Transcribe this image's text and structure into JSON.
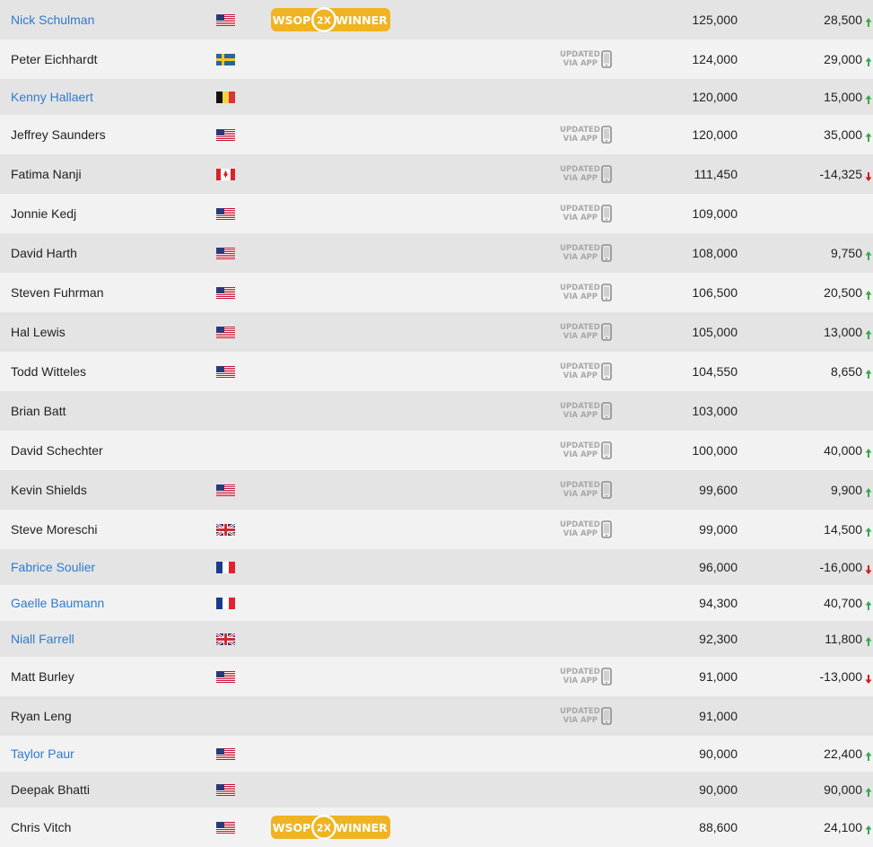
{
  "badge": {
    "left": "WSOP",
    "center": "2X",
    "right": "WINNER"
  },
  "app_badge": {
    "line1": "UPDATED",
    "line2": "VIA APP",
    "icon": "phone-icon"
  },
  "colors": {
    "link": "#2e7bd1",
    "up": "#3aa84a",
    "down": "#d0191e",
    "badge": "#f0b323",
    "row_odd": "#e4e4e4",
    "row_even": "#f2f2f2"
  },
  "players": [
    {
      "name": "Nick Schulman",
      "link": true,
      "flag": "us",
      "badge": true,
      "app": false,
      "chips": "125,000",
      "change": "28,500",
      "trend": "up"
    },
    {
      "name": "Peter Eichhardt",
      "link": false,
      "flag": "se",
      "badge": false,
      "app": true,
      "chips": "124,000",
      "change": "29,000",
      "trend": "up"
    },
    {
      "name": "Kenny Hallaert",
      "link": true,
      "flag": "be",
      "badge": false,
      "app": false,
      "chips": "120,000",
      "change": "15,000",
      "trend": "up"
    },
    {
      "name": "Jeffrey Saunders",
      "link": false,
      "flag": "us",
      "badge": false,
      "app": true,
      "chips": "120,000",
      "change": "35,000",
      "trend": "up"
    },
    {
      "name": "Fatima Nanji",
      "link": false,
      "flag": "ca",
      "badge": false,
      "app": true,
      "chips": "111,450",
      "change": "-14,325",
      "trend": "down"
    },
    {
      "name": "Jonnie Kedj",
      "link": false,
      "flag": "us",
      "badge": false,
      "app": true,
      "chips": "109,000",
      "change": "",
      "trend": ""
    },
    {
      "name": "David Harth",
      "link": false,
      "flag": "us",
      "badge": false,
      "app": true,
      "chips": "108,000",
      "change": "9,750",
      "trend": "up"
    },
    {
      "name": "Steven Fuhrman",
      "link": false,
      "flag": "us",
      "badge": false,
      "app": true,
      "chips": "106,500",
      "change": "20,500",
      "trend": "up"
    },
    {
      "name": "Hal Lewis",
      "link": false,
      "flag": "us",
      "badge": false,
      "app": true,
      "chips": "105,000",
      "change": "13,000",
      "trend": "up"
    },
    {
      "name": "Todd Witteles",
      "link": false,
      "flag": "us",
      "badge": false,
      "app": true,
      "chips": "104,550",
      "change": "8,650",
      "trend": "up"
    },
    {
      "name": "Brian Batt",
      "link": false,
      "flag": "",
      "badge": false,
      "app": true,
      "chips": "103,000",
      "change": "",
      "trend": ""
    },
    {
      "name": "David Schechter",
      "link": false,
      "flag": "",
      "badge": false,
      "app": true,
      "chips": "100,000",
      "change": "40,000",
      "trend": "up"
    },
    {
      "name": "Kevin Shields",
      "link": false,
      "flag": "us",
      "badge": false,
      "app": true,
      "chips": "99,600",
      "change": "9,900",
      "trend": "up"
    },
    {
      "name": "Steve Moreschi",
      "link": false,
      "flag": "gb",
      "badge": false,
      "app": true,
      "chips": "99,000",
      "change": "14,500",
      "trend": "up"
    },
    {
      "name": "Fabrice Soulier",
      "link": true,
      "flag": "fr",
      "badge": false,
      "app": false,
      "chips": "96,000",
      "change": "-16,000",
      "trend": "down"
    },
    {
      "name": "Gaelle Baumann",
      "link": true,
      "flag": "fr",
      "badge": false,
      "app": false,
      "chips": "94,300",
      "change": "40,700",
      "trend": "up"
    },
    {
      "name": "Niall Farrell",
      "link": true,
      "flag": "gb",
      "badge": false,
      "app": false,
      "chips": "92,300",
      "change": "11,800",
      "trend": "up"
    },
    {
      "name": "Matt Burley",
      "link": false,
      "flag": "us",
      "badge": false,
      "app": true,
      "chips": "91,000",
      "change": "-13,000",
      "trend": "down"
    },
    {
      "name": "Ryan Leng",
      "link": false,
      "flag": "",
      "badge": false,
      "app": true,
      "chips": "91,000",
      "change": "",
      "trend": ""
    },
    {
      "name": "Taylor Paur",
      "link": true,
      "flag": "us",
      "badge": false,
      "app": false,
      "chips": "90,000",
      "change": "22,400",
      "trend": "up"
    },
    {
      "name": "Deepak Bhatti",
      "link": false,
      "flag": "us",
      "badge": false,
      "app": false,
      "chips": "90,000",
      "change": "90,000",
      "trend": "up"
    },
    {
      "name": "Chris Vitch",
      "link": false,
      "flag": "us",
      "badge": true,
      "app": false,
      "chips": "88,600",
      "change": "24,100",
      "trend": "up"
    }
  ]
}
